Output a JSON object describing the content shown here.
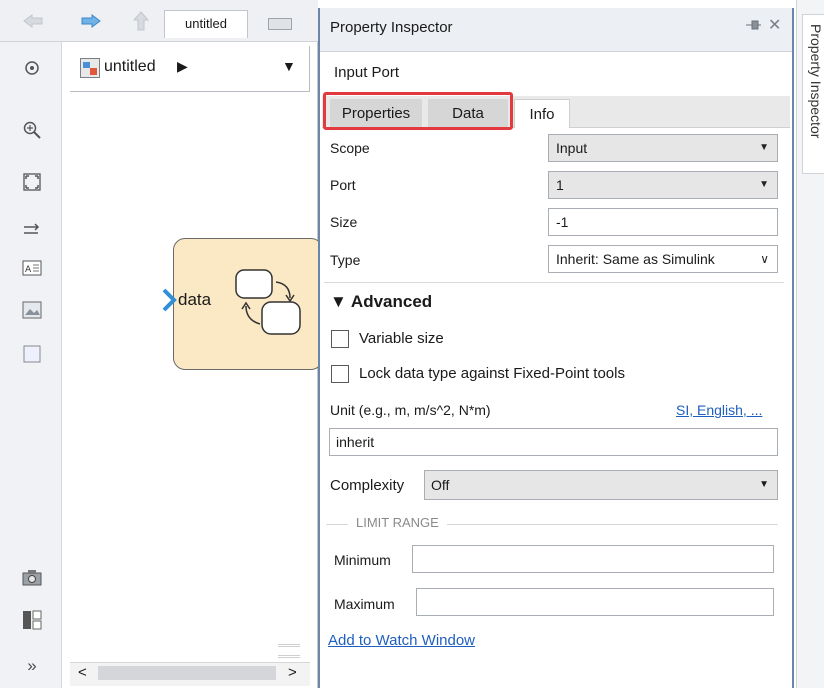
{
  "editor": {
    "tab_label": "untitled",
    "breadcrumb": {
      "label": "untitled",
      "arrow": "▶",
      "dropdown": "▼"
    },
    "chart": {
      "port_label": "data"
    },
    "toolbar_icons": [
      "target-icon",
      "zoom-icon",
      "fit-view-icon",
      "arrows-icon",
      "annotation-icon",
      "image-icon",
      "box-icon",
      "camera-icon",
      "explorer-icon",
      "expand-icon"
    ],
    "collapse_glyph": "»",
    "scroll": {
      "left": "<",
      "right": ">"
    }
  },
  "inspector": {
    "title": "Property Inspector",
    "close_glyph": "✕",
    "subtitle": "Input Port",
    "tabs": [
      {
        "label": "Properties"
      },
      {
        "label": "Data"
      },
      {
        "label": "Info"
      }
    ],
    "highlight_color": "#e23a3f",
    "properties": {
      "scope": {
        "label": "Scope",
        "value": "Input"
      },
      "port": {
        "label": "Port",
        "value": "1"
      },
      "size": {
        "label": "Size",
        "value": "-1"
      },
      "type": {
        "label": "Type",
        "value": "Inherit: Same as Simulink"
      }
    },
    "advanced": {
      "header": "▼ Advanced",
      "variable_size": {
        "label": "Variable size",
        "checked": false
      },
      "lock_data_type": {
        "label": "Lock data type against Fixed-Point tools",
        "checked": false
      },
      "unit_label": "Unit (e.g., m, m/s^2, N*m)",
      "unit_link": "SI, English, ...",
      "unit_value": "inherit",
      "complexity_label": "Complexity",
      "complexity_value": "Off",
      "limit_range_title": "LIMIT RANGE",
      "minimum_label": "Minimum",
      "minimum_value": "",
      "maximum_label": "Maximum",
      "maximum_value": ""
    },
    "watch_link": "Add to Watch Window"
  },
  "side_panel": {
    "label": "Property Inspector"
  },
  "colors": {
    "accent": "#6b86a8",
    "link": "#1f5fbf",
    "chart_fill": "#fbe8c4"
  }
}
